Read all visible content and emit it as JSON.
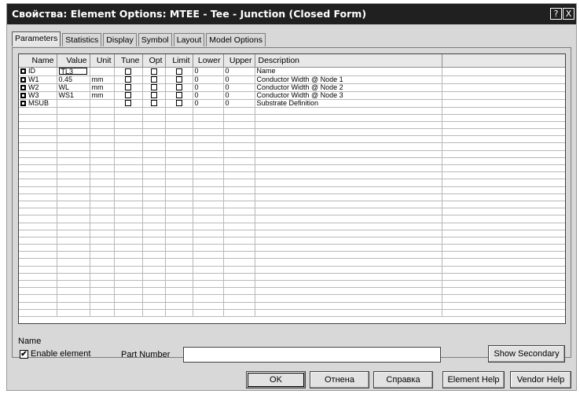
{
  "window": {
    "title": "Свойства: Element Options: MTEE - Tee - Junction (Closed Form)",
    "help_glyph": "?",
    "close_glyph": "X"
  },
  "tabs": [
    "Parameters",
    "Statistics",
    "Display",
    "Symbol",
    "Layout",
    "Model Options"
  ],
  "grid": {
    "headers": [
      "Name",
      "Value",
      "Unit",
      "Tune",
      "Opt",
      "Limit",
      "Lower",
      "Upper",
      "Description",
      ""
    ],
    "rows": [
      {
        "name": "ID",
        "value": "TL3",
        "unit": "",
        "lower": "0",
        "upper": "0",
        "description": "Name"
      },
      {
        "name": "W1",
        "value": "0.45",
        "unit": "mm",
        "lower": "0",
        "upper": "0",
        "description": "Conductor Width @ Node 1"
      },
      {
        "name": "W2",
        "value": "WL",
        "unit": "mm",
        "lower": "0",
        "upper": "0",
        "description": "Conductor Width @ Node 2"
      },
      {
        "name": "W3",
        "value": "WS1",
        "unit": "mm",
        "lower": "0",
        "upper": "0",
        "description": "Conductor Width @ Node 3"
      },
      {
        "name": "MSUB",
        "value": "",
        "unit": "",
        "lower": "0",
        "upper": "0",
        "description": "Substrate Definition"
      }
    ]
  },
  "status": {
    "selected_name": "Name"
  },
  "options": {
    "enable_label": "Enable element",
    "enable_checked": "✔",
    "part_number_label": "Part Number",
    "part_number_value": "",
    "show_secondary_label": "Show Secondary"
  },
  "buttons": {
    "ok": "OK",
    "cancel": "Отнена",
    "help": "Справка",
    "element_help": "Element Help",
    "vendor_help": "Vendor Help"
  }
}
